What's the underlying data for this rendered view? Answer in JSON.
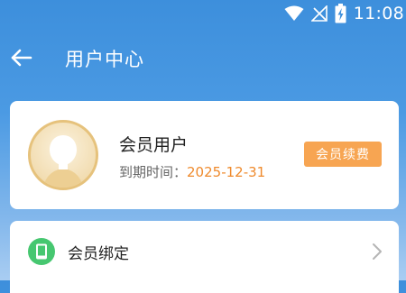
{
  "status_bar": {
    "time": "11:08",
    "icons": [
      "wifi-icon",
      "no-signal-icon",
      "battery-charging-icon"
    ]
  },
  "header": {
    "title": "用户中心",
    "back_icon": "arrow-left-icon"
  },
  "profile": {
    "name": "会员用户",
    "expiry_label": "到期时间：",
    "expiry_date": "2025-12-31",
    "renew_label": "会员续费",
    "accent_color": "#ef8a2c",
    "button_color": "#f7a552"
  },
  "menu": {
    "items": [
      {
        "label": "会员绑定",
        "icon": "phone-icon",
        "icon_color": "#46c770"
      }
    ]
  }
}
